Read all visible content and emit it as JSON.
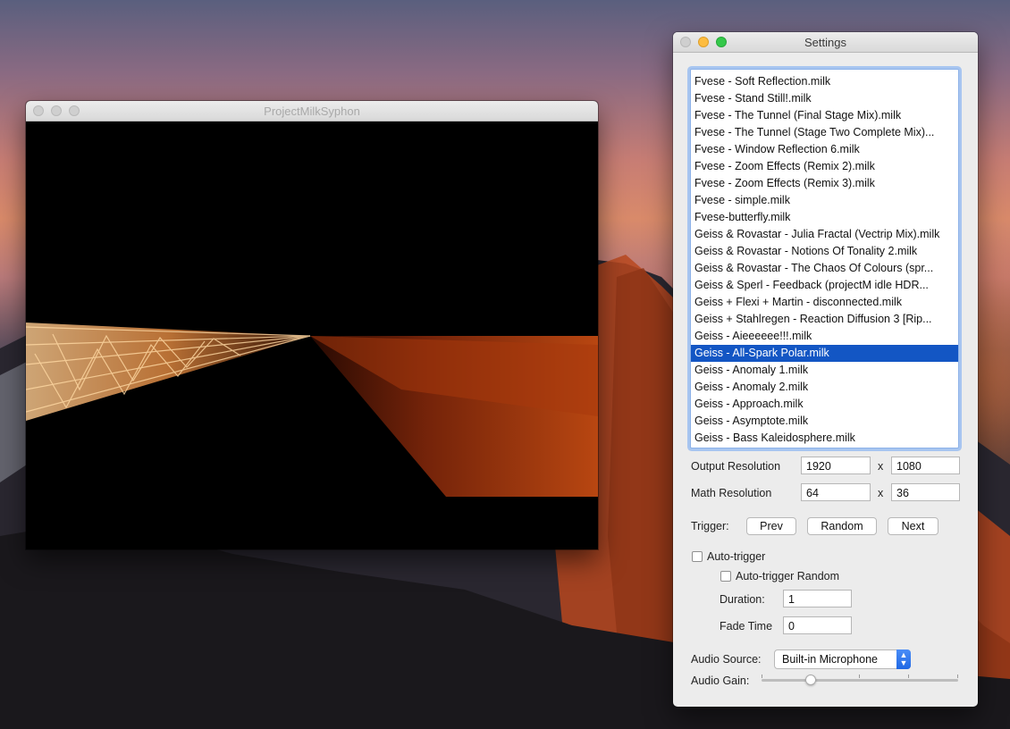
{
  "desktop": {
    "wallpaper": "mountain-sunset"
  },
  "main_window": {
    "title": "ProjectMilkSyphon",
    "colors": {
      "beam_light": "#f2c28a",
      "beam_dark": "#c24a12",
      "background": "#000000"
    }
  },
  "settings": {
    "title": "Settings",
    "presets": [
      "Fvese - Soft Reflection.milk",
      "Fvese - Stand Still!.milk",
      "Fvese - The Tunnel (Final Stage Mix).milk",
      "Fvese - The Tunnel (Stage Two Complete Mix)...",
      "Fvese - Window Reflection 6.milk",
      "Fvese - Zoom Effects (Remix 2).milk",
      "Fvese - Zoom Effects (Remix 3).milk",
      "Fvese - simple.milk",
      "Fvese-butterfly.milk",
      "Geiss & Rovastar - Julia Fractal (Vectrip Mix).milk",
      "Geiss & Rovastar - Notions Of Tonality 2.milk",
      "Geiss & Rovastar - The Chaos Of Colours (spr...",
      "Geiss & Sperl - Feedback (projectM idle HDR...",
      "Geiss + Flexi + Martin - disconnected.milk",
      "Geiss + Stahlregen - Reaction Diffusion 3 [Rip...",
      "Geiss - Aieeeeee!!!.milk",
      "Geiss - All-Spark Polar.milk",
      "Geiss - Anomaly 1.milk",
      "Geiss - Anomaly 2.milk",
      "Geiss - Approach.milk",
      "Geiss - Asymptote.milk",
      "Geiss - Bass Kaleidosphere.milk"
    ],
    "selected_preset": "Geiss - All-Spark Polar.milk",
    "output_resolution": {
      "label": "Output Resolution",
      "width": "1920",
      "x": "x",
      "height": "1080"
    },
    "math_resolution": {
      "label": "Math Resolution",
      "width": "64",
      "x": "x",
      "height": "36"
    },
    "trigger": {
      "label": "Trigger:",
      "prev": "Prev",
      "random": "Random",
      "next": "Next"
    },
    "auto_trigger": {
      "label": "Auto-trigger",
      "checked": false
    },
    "auto_trigger_random": {
      "label": "Auto-trigger Random",
      "checked": false
    },
    "duration": {
      "label": "Duration:",
      "value": "1"
    },
    "fade_time": {
      "label": "Fade Time",
      "value": "0"
    },
    "audio_source": {
      "label": "Audio Source:",
      "value": "Built-in Microphone"
    },
    "audio_gain": {
      "label": "Audio Gain:",
      "level": 0.25
    },
    "accent_color": "#1356c4"
  }
}
